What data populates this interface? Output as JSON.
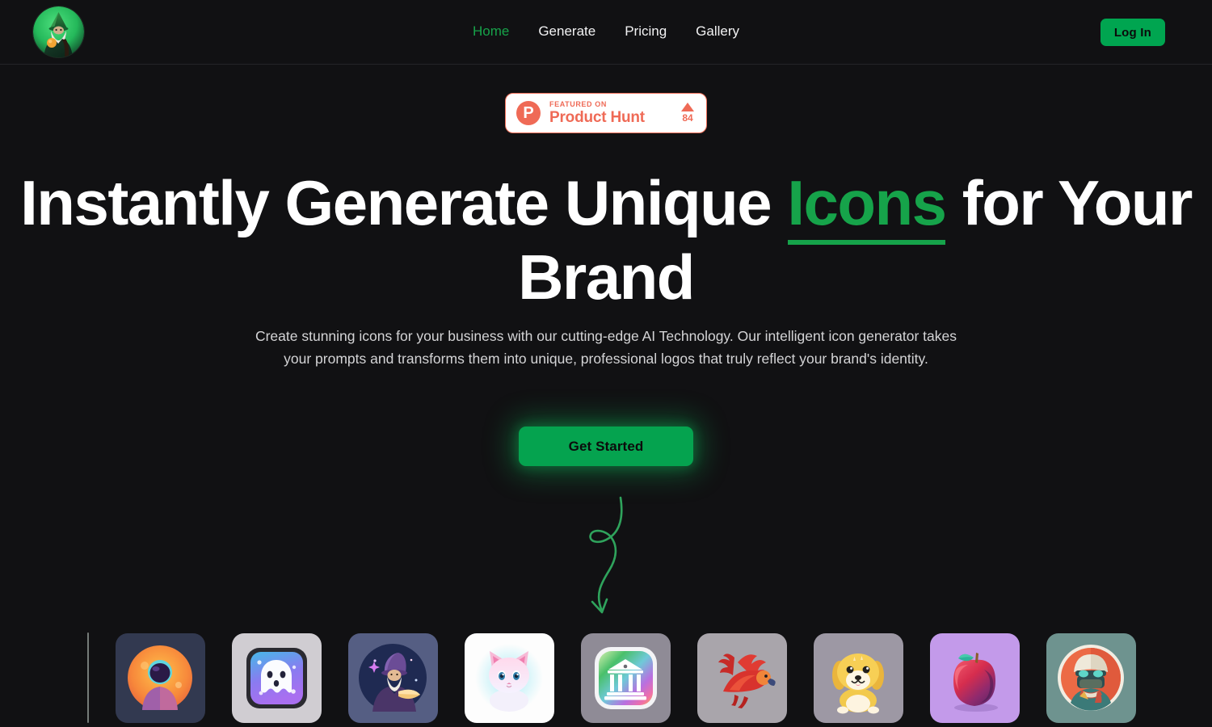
{
  "brand": {
    "logo_icon": "wizard-avatar-icon",
    "logo_alt": "AI Icon Wizard"
  },
  "header": {
    "nav": [
      {
        "label": "Home",
        "active": true
      },
      {
        "label": "Generate",
        "active": false
      },
      {
        "label": "Pricing",
        "active": false
      },
      {
        "label": "Gallery",
        "active": false
      }
    ],
    "login_label": "Log In"
  },
  "hero": {
    "badge": {
      "logo_letter": "P",
      "featured_label": "FEATURED ON",
      "product_name": "Product Hunt",
      "upvote_icon": "upvote-triangle-icon",
      "upvote_count": "84"
    },
    "headline_part1": "Instantly Generate Unique ",
    "headline_accent": "Icons",
    "headline_part2": " for Your Brand",
    "subtitle": "Create stunning icons for your business with our cutting-edge AI Technology. Our intelligent icon generator takes your prompts and transforms them into unique, professional logos that truly reflect your brand's identity.",
    "cta_label": "Get Started",
    "arrow_icon": "curly-down-arrow-icon"
  },
  "carousel": {
    "items": [
      {
        "name": "astronaut-icon",
        "bg": "#323950"
      },
      {
        "name": "ghost-icon",
        "bg": "#d0cdd2"
      },
      {
        "name": "wizard-icon",
        "bg": "#555e83"
      },
      {
        "name": "kitten-icon",
        "bg": "#fdfdfd"
      },
      {
        "name": "bank-icon",
        "bg": "#8f8b96"
      },
      {
        "name": "parrot-icon",
        "bg": "#a9a5ab"
      },
      {
        "name": "puppy-icon",
        "bg": "#9d98a4"
      },
      {
        "name": "apple-icon",
        "bg": "#c39aea"
      },
      {
        "name": "soldier-icon",
        "bg": "#6e938f"
      }
    ]
  },
  "colors": {
    "background": "#111113",
    "accent_green": "#16a34a",
    "button_green": "#05a34f",
    "product_hunt_coral": "#ef6a56",
    "text_primary": "#ffffff",
    "text_muted": "#d4d4d6"
  }
}
